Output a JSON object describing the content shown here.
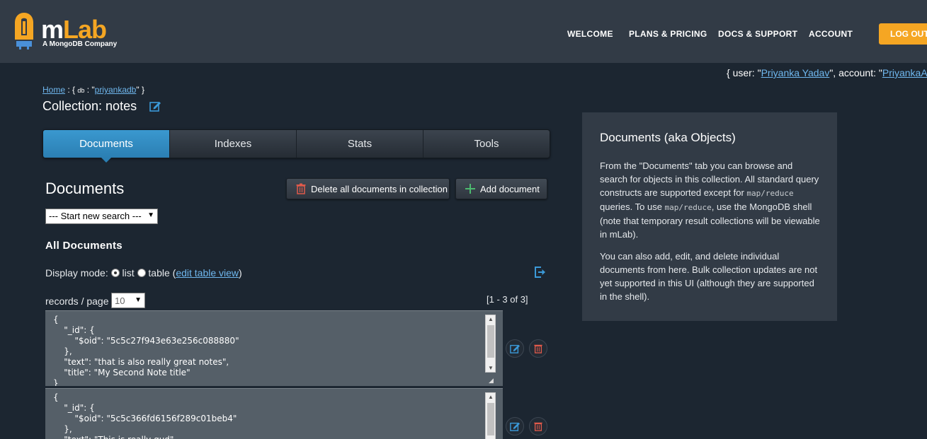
{
  "header": {
    "logo_main": "m",
    "logo_accent": "Lab",
    "logo_sub": "A MongoDB Company",
    "nav": [
      "WELCOME",
      "PLANS & PRICING",
      "DOCS & SUPPORT",
      "ACCOUNT"
    ],
    "logout_label": "LOG OUT",
    "accent_color": "#f5a623"
  },
  "userline": {
    "prefix": "{ user: \"",
    "user": "Priyanka Yadav",
    "mid": "\", account: \"",
    "account": "PriyankaAPI"
  },
  "breadcrumb": {
    "home": "Home",
    "sep1": " : { ",
    "db_label": "db",
    "sep2": " : \"",
    "db_name": "priyankadb",
    "end": "\" }"
  },
  "collection_title": "Collection: notes",
  "tabs": [
    "Documents",
    "Indexes",
    "Stats",
    "Tools"
  ],
  "documents": {
    "heading": "Documents",
    "delete_all_label": "Delete all documents in collection",
    "add_label": "Add document",
    "search_select": "--- Start new search ---",
    "all_docs_label": "All Documents",
    "display_mode_label": "Display mode:",
    "mode_list": "list",
    "mode_table": "table",
    "edit_table_view": "edit table view",
    "records_label": "records / page",
    "records_value": "10",
    "range": "[1 - 3 of 3]",
    "items": [
      "{\n    \"_id\": {\n        \"$oid\": \"5c5c27f943e63e256c088880\"\n    },\n    \"text\": \"that is also really great notes\",\n    \"title\": \"My Second Note title\"\n}",
      "{\n    \"_id\": {\n        \"$oid\": \"5c5c366fd6156f289c01beb4\"\n    },\n    \"text\": \"This is really gud\""
    ]
  },
  "info": {
    "title": "Documents (aka Objects)",
    "p1_a": "From the \"Documents\" tab you can browse and search for objects in this collection. All standard query constructs are supported except for ",
    "p1_code1": "map/reduce",
    "p1_b": " queries. To use ",
    "p1_code2": "map/reduce",
    "p1_c": ", use the MongoDB shell (note that temporary result collections will be viewable in mLab).",
    "p2": "You can also add, edit, and delete individual documents from here. Bulk collection updates are not yet supported in this UI (although they are supported in the shell)."
  }
}
